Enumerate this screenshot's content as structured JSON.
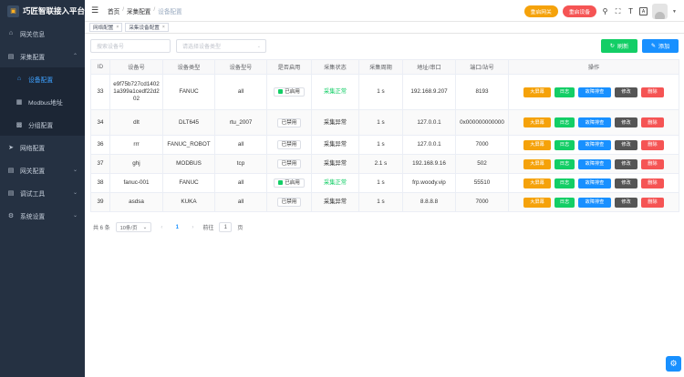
{
  "app": {
    "title": "巧匠智联接入平台"
  },
  "sidebar": {
    "items": [
      {
        "label": "网关信息",
        "icon": "home-icon"
      },
      {
        "label": "采集配置",
        "icon": "briefcase-icon",
        "expanded": true,
        "children": [
          {
            "label": "设备配置",
            "icon": "home-icon",
            "active": true
          },
          {
            "label": "Modbus地址",
            "icon": "table-icon"
          },
          {
            "label": "分组配置",
            "icon": "grid-icon"
          }
        ]
      },
      {
        "label": "网络配置",
        "icon": "send-icon"
      },
      {
        "label": "网关配置",
        "icon": "briefcase-icon"
      },
      {
        "label": "调试工具",
        "icon": "briefcase-icon"
      },
      {
        "label": "系统设置",
        "icon": "gear-icon"
      }
    ]
  },
  "header": {
    "breadcrumb": [
      "首页",
      "采集配置",
      "设备配置"
    ],
    "restart_gateway": "重启网关",
    "restart_device": "重启设备"
  },
  "tags": [
    "网络配置",
    "采集设备配置"
  ],
  "filters": {
    "device_no_placeholder": "搜索设备号",
    "device_type_placeholder": "请选择设备类型"
  },
  "actions": {
    "refresh": "刷新",
    "add": "添加"
  },
  "table": {
    "headers": [
      "ID",
      "设备号",
      "设备类型",
      "设备型号",
      "是否启用",
      "采集状态",
      "采集周期",
      "地址/串口",
      "端口/站号",
      "操作"
    ],
    "rows": [
      {
        "id": "33",
        "device_no": "e9f75b727cd14021a399a1cedf22d202",
        "type": "FANUC",
        "model": "all",
        "enabled": "已启用",
        "status": "采集正常",
        "status_ok": true,
        "cycle": "1 s",
        "address": "192.168.9.207",
        "port": "8193"
      },
      {
        "id": "34",
        "device_no": "dlt",
        "type": "DLT645",
        "model": "rtu_2007",
        "enabled": "已禁用",
        "status": "采集异常",
        "status_ok": false,
        "cycle": "1 s",
        "address": "127.0.0.1",
        "port": "0x000000000000"
      },
      {
        "id": "36",
        "device_no": "rrr",
        "type": "FANUC_ROBOT",
        "model": "all",
        "enabled": "已禁用",
        "status": "采集异常",
        "status_ok": false,
        "cycle": "1 s",
        "address": "127.0.0.1",
        "port": "7000"
      },
      {
        "id": "37",
        "device_no": "ghj",
        "type": "MODBUS",
        "model": "tcp",
        "enabled": "已禁用",
        "status": "采集异常",
        "status_ok": false,
        "cycle": "2.1 s",
        "address": "192.168.9.16",
        "port": "502"
      },
      {
        "id": "38",
        "device_no": "fanuc-001",
        "type": "FANUC",
        "model": "all",
        "enabled": "已启用",
        "status": "采集正常",
        "status_ok": true,
        "cycle": "1 s",
        "address": "frp.woody.vip",
        "port": "55510"
      },
      {
        "id": "39",
        "device_no": "asdsa",
        "type": "KUKA",
        "model": "all",
        "enabled": "已禁用",
        "status": "采集异常",
        "status_ok": false,
        "cycle": "1 s",
        "address": "8.8.8.8",
        "port": "7000"
      }
    ],
    "row_actions": [
      "大屏幕",
      "日志",
      "故障排查",
      "修改",
      "删除"
    ]
  },
  "pagination": {
    "total": "共 6 条",
    "page_size": "10条/页",
    "current": "1",
    "goto_label": "前往",
    "goto_value": "1",
    "page_suffix": "页"
  }
}
